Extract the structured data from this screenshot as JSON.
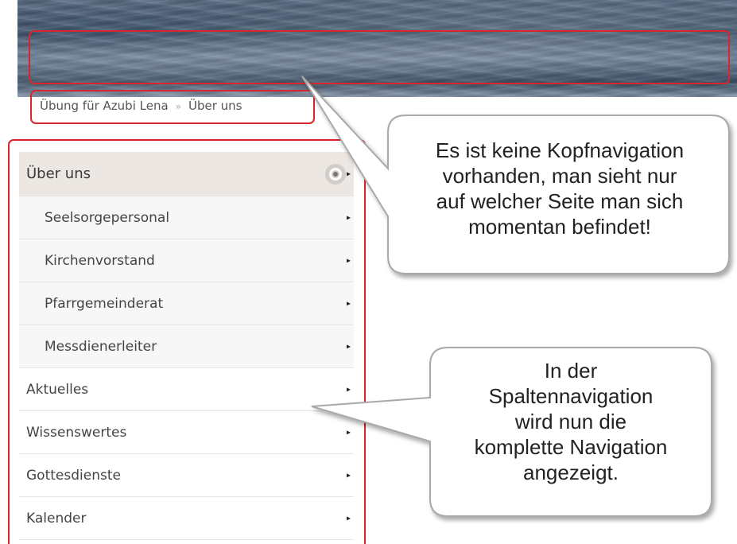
{
  "breadcrumb": {
    "items": [
      "Übung für Azubi Lena",
      "Über uns"
    ],
    "separator": "»"
  },
  "nav": {
    "active": {
      "label": "Über uns"
    },
    "subitems": [
      {
        "label": "Seelsorgepersonal"
      },
      {
        "label": "Kirchenvorstand"
      },
      {
        "label": "Pfarrgemeinderat"
      },
      {
        "label": "Messdienerleiter"
      }
    ],
    "items": [
      {
        "label": "Aktuelles"
      },
      {
        "label": "Wissenswertes"
      },
      {
        "label": "Gottesdienste"
      },
      {
        "label": "Kalender"
      }
    ],
    "arrow_glyph": "▸"
  },
  "callouts": {
    "top": {
      "lines": [
        "Es ist keine Kopfnavigation",
        "vorhanden, man sieht nur",
        "auf welcher Seite man sich",
        "momentan befindet!"
      ]
    },
    "bottom": {
      "lines": [
        "In der",
        "Spaltennavigation",
        "wird nun die",
        "komplette Navigation",
        "angezeigt."
      ]
    }
  },
  "colors": {
    "highlight_border": "#d9262c",
    "active_item_bg": "#ece7e2",
    "subitem_bg": "#f7f7f7"
  }
}
